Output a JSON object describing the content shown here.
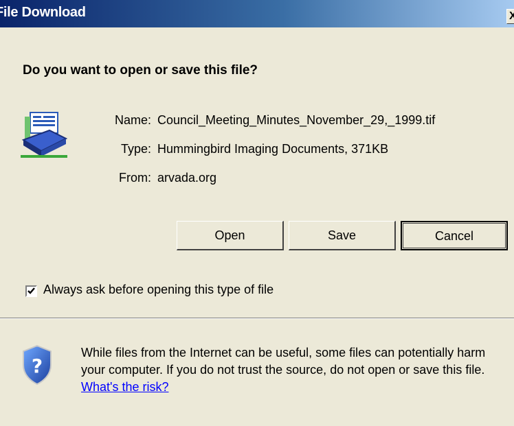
{
  "window": {
    "title": "File Download",
    "close_label": "X"
  },
  "dialog": {
    "question": "Do you want to open or save this file?",
    "file_icon": "document-scanner-icon",
    "info": {
      "name_label": "Name:",
      "name_value": "Council_Meeting_Minutes_November_29,_1999.tif",
      "type_label": "Type:",
      "type_value": "Hummingbird Imaging Documents, 371KB",
      "from_label": "From:",
      "from_value": "arvada.org"
    },
    "buttons": {
      "open": "Open",
      "save": "Save",
      "cancel": "Cancel"
    },
    "always_ask": {
      "label": "Always ask before opening this type of file",
      "checked": true
    },
    "warning": {
      "icon": "security-shield-question-icon",
      "text": "While files from the Internet can be useful, some files can potentially harm your computer. If you do not trust the source, do not open or save this file.",
      "link": "What's the risk?"
    }
  },
  "colors": {
    "titlebar_start": "#0a246a",
    "titlebar_end": "#a6caf0",
    "dialog_bg": "#ece9d8",
    "link": "#0000ff"
  }
}
